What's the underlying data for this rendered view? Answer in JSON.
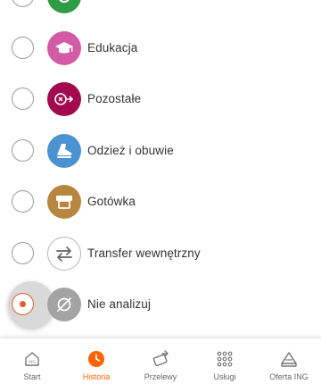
{
  "colors": {
    "accent": "#ff6200",
    "radio_selected": "#e06026",
    "icon_green": "#2e9b45",
    "icon_pink": "#d35ba6",
    "icon_maroon": "#a3094f",
    "icon_blue": "#4b92d1",
    "icon_gold": "#b8873f",
    "icon_gray": "#a3a3a3"
  },
  "categories": [
    {
      "label": "",
      "icon": "green-category-icon",
      "selected": false
    },
    {
      "label": "Edukacja",
      "icon": "graduation-cap-icon",
      "selected": false
    },
    {
      "label": "Pozostałe",
      "icon": "other-coins-icon",
      "selected": false
    },
    {
      "label": "Odzież i obuwie",
      "icon": "shoe-icon",
      "selected": false
    },
    {
      "label": "Gotówka",
      "icon": "cash-register-icon",
      "selected": false
    },
    {
      "label": "Transfer wewnętrzny",
      "icon": "transfer-arrows-icon",
      "selected": false
    },
    {
      "label": "Nie analizuj",
      "icon": "eye-off-icon",
      "selected": true
    }
  ],
  "bottom_nav": {
    "items": [
      {
        "label": "Start",
        "icon": "home-icon",
        "active": false
      },
      {
        "label": "Historia",
        "icon": "clock-icon",
        "active": true
      },
      {
        "label": "Przelewy",
        "icon": "transfer-icon",
        "active": false
      },
      {
        "label": "Usługi",
        "icon": "grid-icon",
        "active": false
      },
      {
        "label": "Oferta ING",
        "icon": "offer-icon",
        "active": false
      }
    ],
    "start_icon_text": "ING"
  }
}
